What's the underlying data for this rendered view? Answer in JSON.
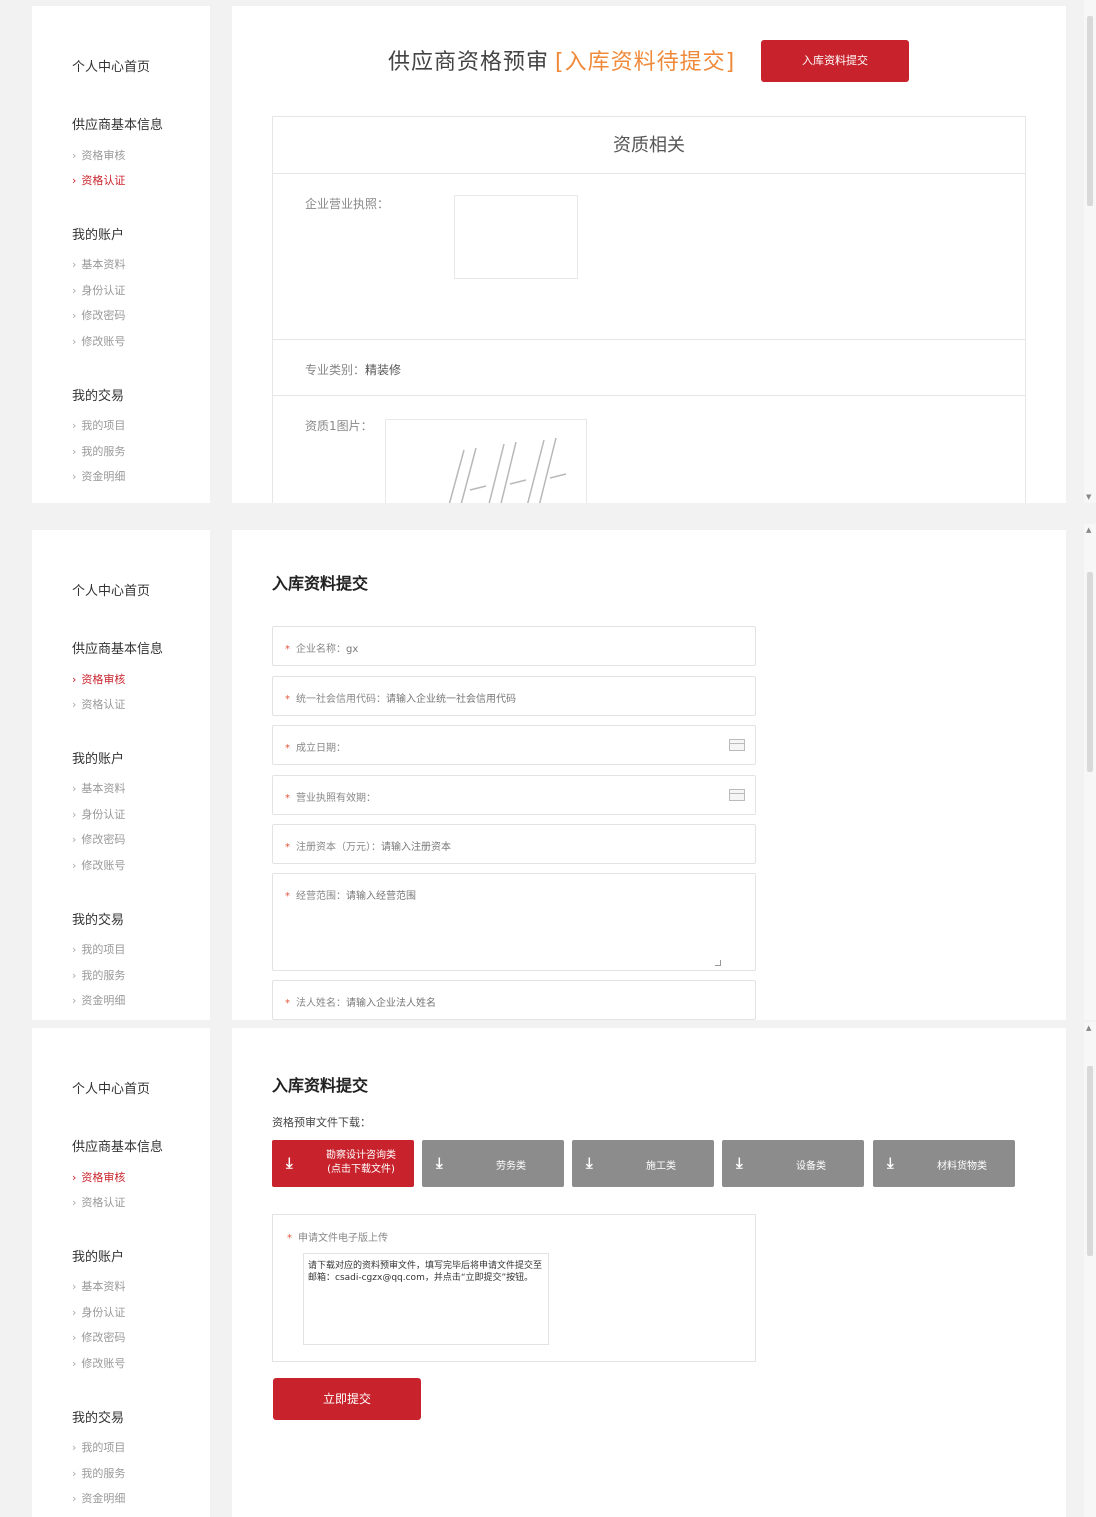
{
  "sidebar": {
    "home": "个人中心首页",
    "groups": [
      {
        "title": "供应商基本信息",
        "items": [
          "资格审核",
          "资格认证"
        ]
      },
      {
        "title": "我的账户",
        "items": [
          "基本资料",
          "身份认证",
          "修改密码",
          "修改账号"
        ]
      },
      {
        "title": "我的交易",
        "items": [
          "我的项目",
          "我的服务",
          "资金明细"
        ]
      }
    ]
  },
  "panel1": {
    "title": "供应商资格预审",
    "status": "[入库资料待提交]",
    "submit_button": "入库资料提交",
    "section_title": "资质相关",
    "license_label": "企业营业执照：",
    "category_label": "专业类别：",
    "category_value": "精装修",
    "cert_image_label": "资质1图片："
  },
  "panel2": {
    "title": "入库资料提交",
    "fields": [
      {
        "label": "企业名称：",
        "value": "gx"
      },
      {
        "label": "统一社会信用代码：",
        "value": "请输入企业统一社会信用代码"
      },
      {
        "label": "成立日期：",
        "value": ""
      },
      {
        "label": "营业执照有效期：",
        "value": ""
      },
      {
        "label": "注册资本（万元）：",
        "value": "请输入注册资本"
      },
      {
        "label": "经营范围：",
        "value": "请输入经营范围"
      },
      {
        "label": "法人姓名：",
        "value": "请输入企业法人姓名"
      }
    ]
  },
  "panel3": {
    "title": "入库资料提交",
    "download_label": "资格预审文件下载：",
    "downloads": [
      {
        "label": "勘察设计咨询类",
        "sub": "(点击下载文件)"
      },
      {
        "label": "劳务类"
      },
      {
        "label": "施工类"
      },
      {
        "label": "设备类"
      },
      {
        "label": "材料货物类"
      }
    ],
    "upload_label": "申请文件电子版上传",
    "note": "请下载对应的资料预审文件，填写完毕后将申请文件提交至邮箱：csadi-cgzx@qq.com，并点击“立即提交”按钮。",
    "submit_button": "立即提交"
  },
  "colors": {
    "accent": "#c8232c",
    "status": "#f08a3b",
    "button_gray": "#8c8c8c"
  },
  "icons": {
    "download": "download-icon",
    "calendar": "calendar-icon",
    "chevron": "chevron-right-icon"
  }
}
